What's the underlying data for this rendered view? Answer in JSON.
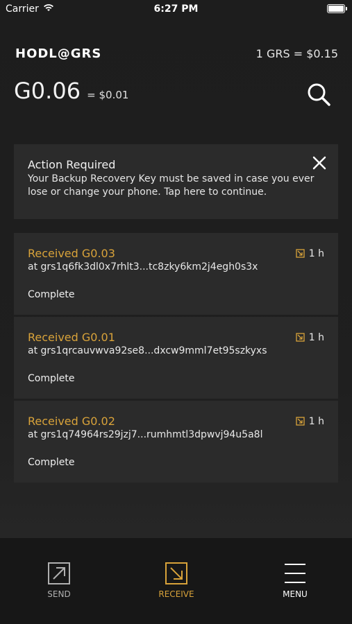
{
  "status_bar": {
    "carrier": "Carrier",
    "time": "6:27 PM",
    "wifi_icon": "wifi-icon",
    "battery_icon": "battery-icon"
  },
  "header": {
    "logo_text": "HODL@GRS",
    "rate": "1 GRS = $0.15",
    "balance_main": "G0.06",
    "balance_fiat": "= $0.01",
    "search_icon": "search-icon"
  },
  "alert": {
    "title": "Action Required",
    "body": "Your Backup Recovery Key must be saved in case you ever lose or change your phone. Tap here to continue.",
    "close_icon": "close-icon"
  },
  "transactions": [
    {
      "title": "Received G0.03",
      "address": "at grs1q6fk3dl0x7rhlt3...tc8zky6km2j4egh0s3x",
      "status": "Complete",
      "time": "1 h",
      "icon": "receive-arrow-icon"
    },
    {
      "title": "Received G0.01",
      "address": "at grs1qrcauvwva92se8...dxcw9mml7et95szkyxs",
      "status": "Complete",
      "time": "1 h",
      "icon": "receive-arrow-icon"
    },
    {
      "title": "Received G0.02",
      "address": "at grs1q74964rs29jzj7...rumhmtl3dpwvj94u5a8l",
      "status": "Complete",
      "time": "1 h",
      "icon": "receive-arrow-icon"
    }
  ],
  "tabbar": {
    "send": "SEND",
    "receive": "RECEIVE",
    "menu": "MENU"
  },
  "colors": {
    "accent": "#d9a33a",
    "card": "#2b2b2b",
    "background": "#1d1d1d",
    "tabbar": "#171717"
  }
}
